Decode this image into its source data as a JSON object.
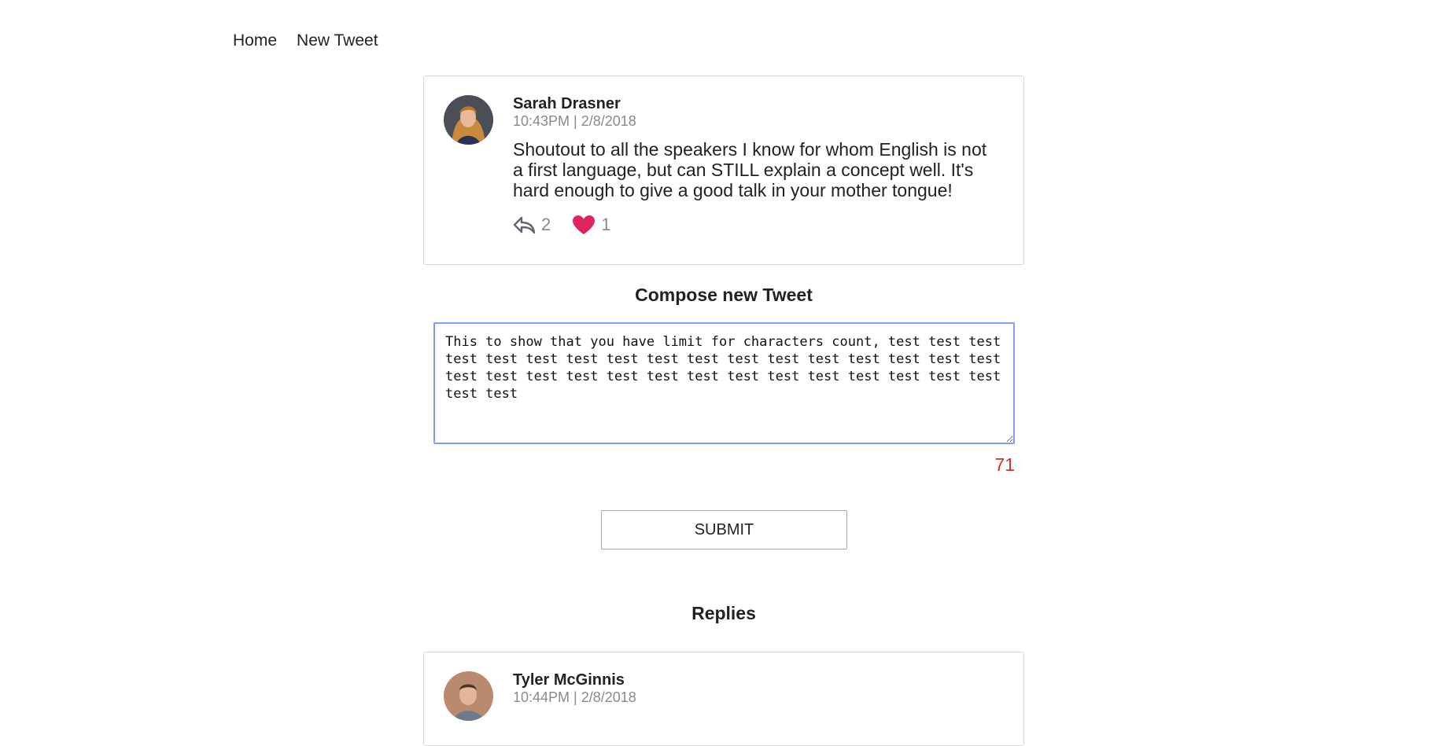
{
  "nav": {
    "home_label": "Home",
    "new_tweet_label": "New Tweet"
  },
  "main_tweet": {
    "author": "Sarah Drasner",
    "timestamp": "10:43PM | 2/8/2018",
    "text": "Shoutout to all the speakers I know for whom English is not a first language, but can STILL explain a concept well. It's hard enough to give a good talk in your mother tongue!",
    "reply_count": "2",
    "like_count": "1",
    "like_color": "#e0245e"
  },
  "compose": {
    "title": "Compose new Tweet",
    "text": "This to show that you have limit for characters count, test test test test test test test test test test test test test test test test test test test test test test test test test test test test test test test test test",
    "remaining_count": "71",
    "remaining_color": "#d0312d",
    "submit_label": "SUBMIT"
  },
  "replies": {
    "title": "Replies",
    "items": [
      {
        "author": "Tyler McGinnis",
        "timestamp": "10:44PM | 2/8/2018"
      }
    ]
  }
}
